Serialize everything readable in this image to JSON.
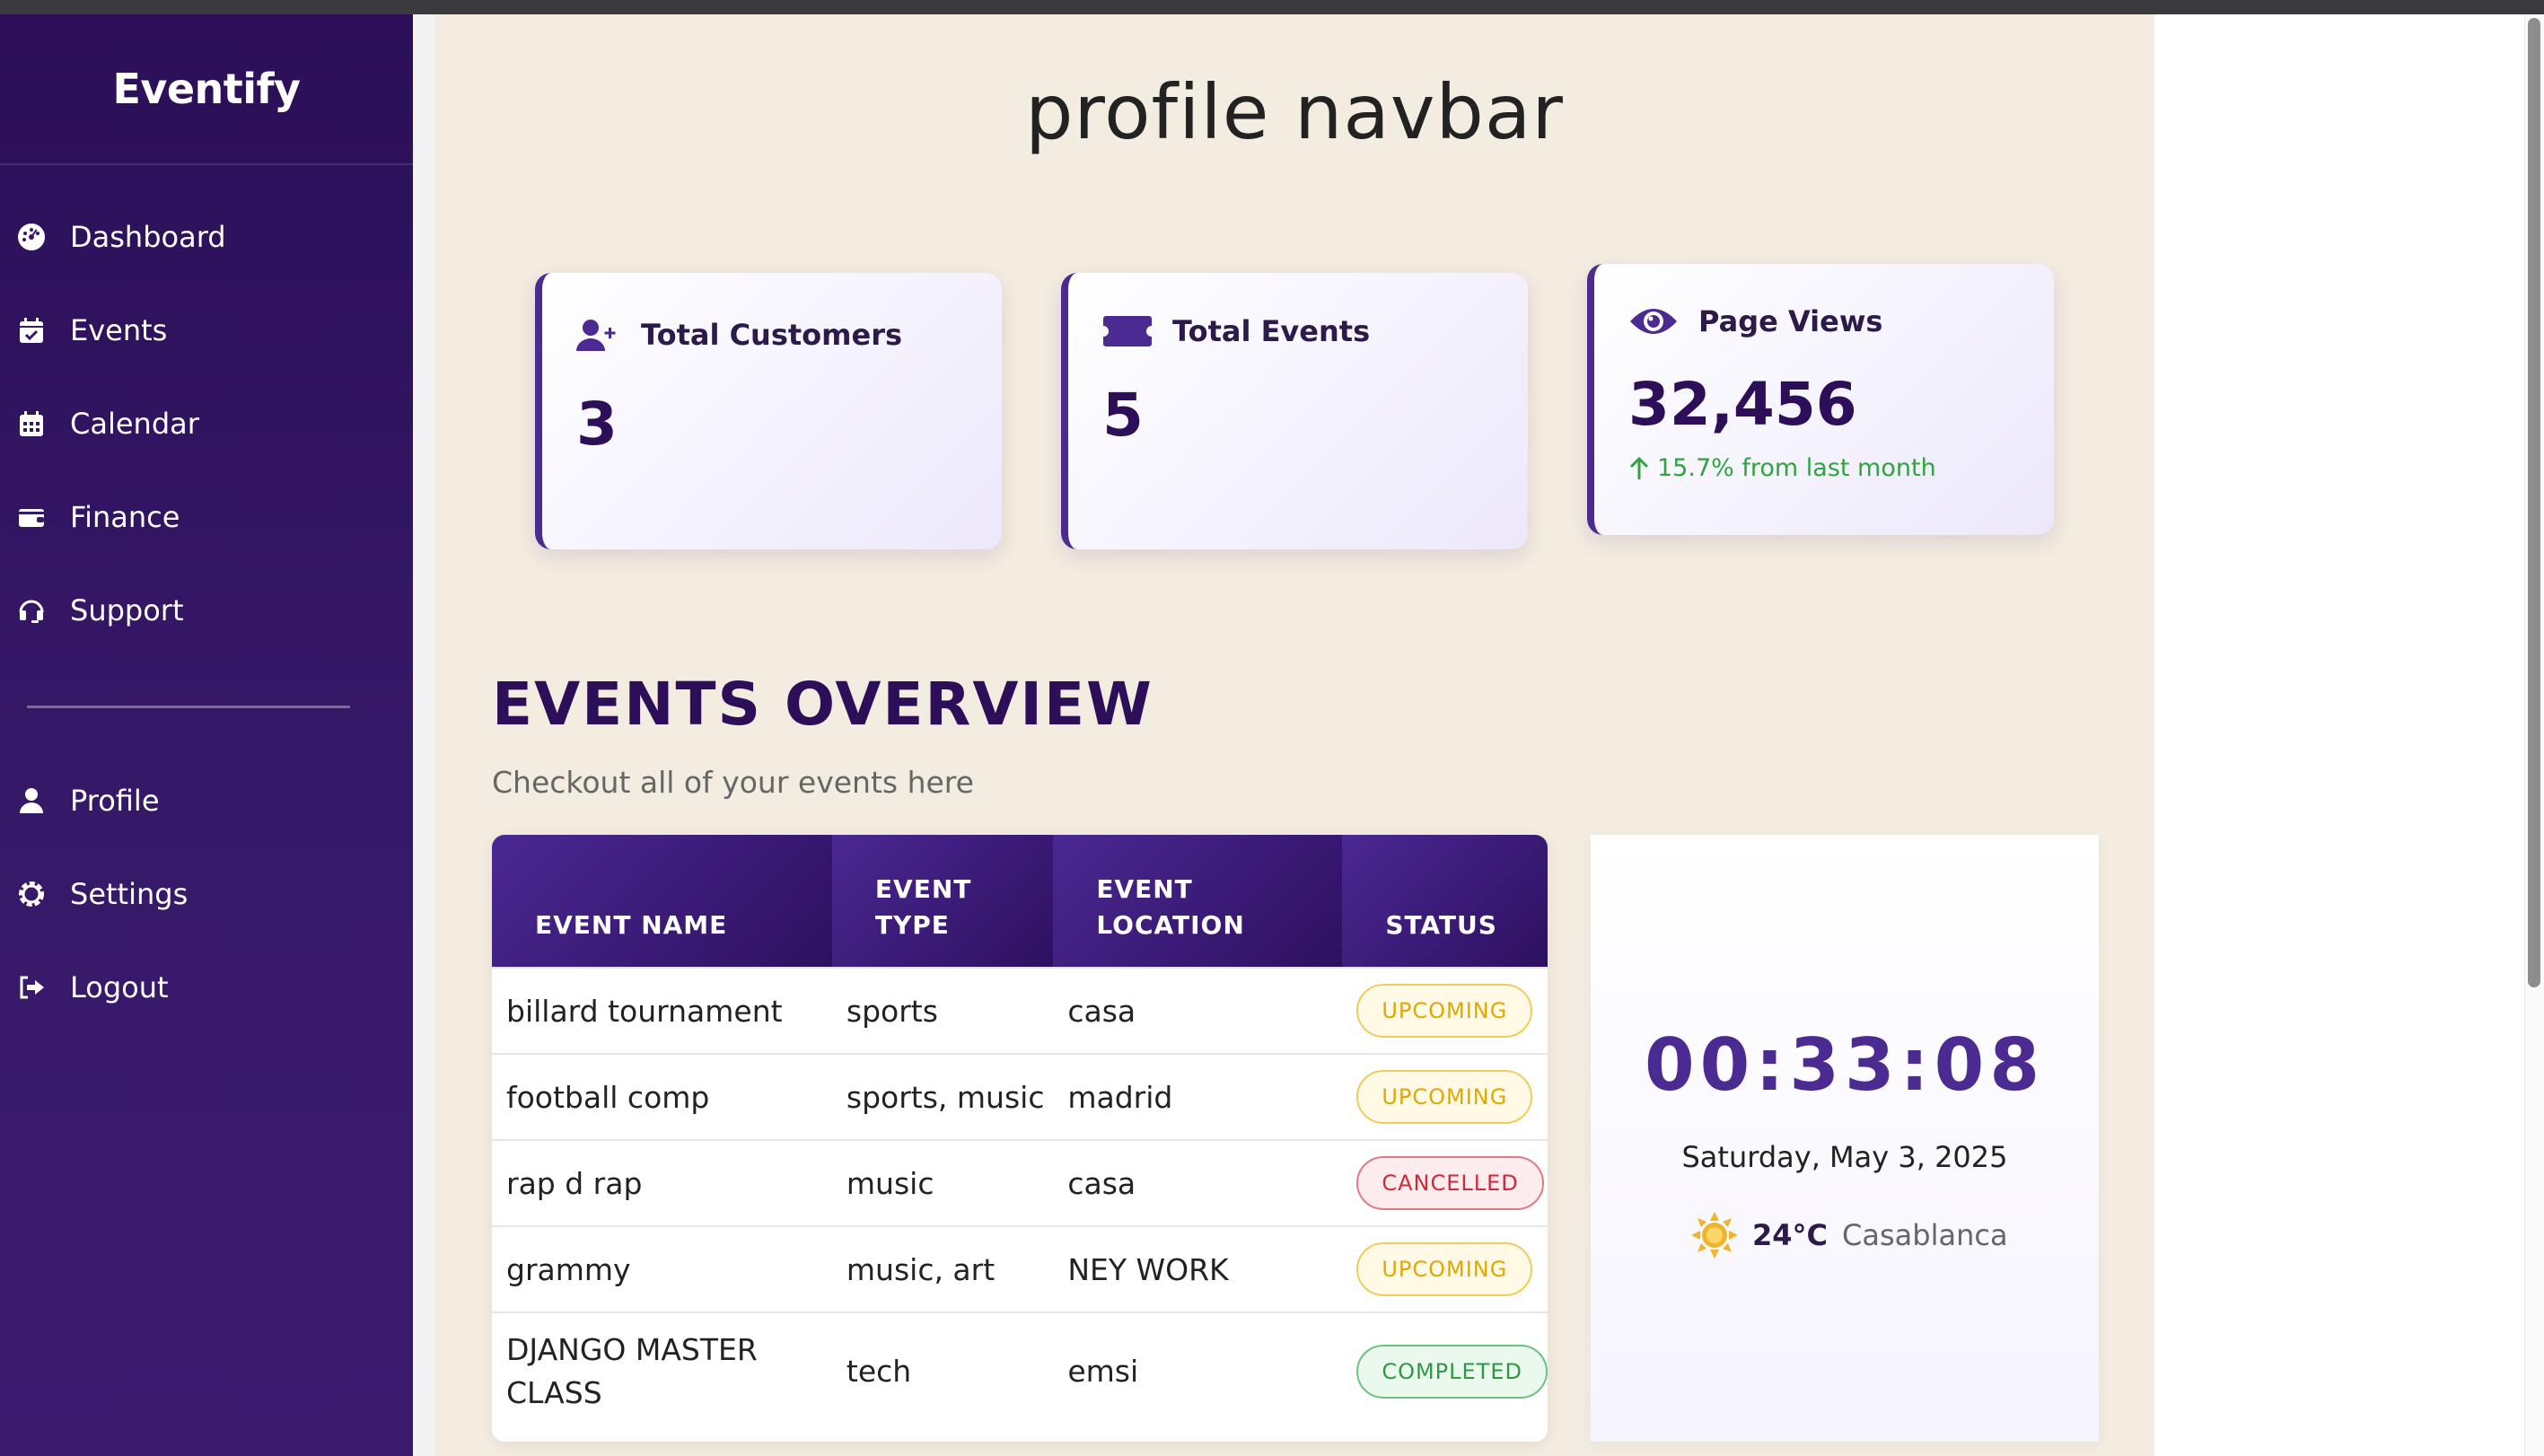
{
  "sidebar": {
    "brand": "Eventify",
    "items": [
      {
        "label": "Dashboard",
        "icon": "dashboard-icon"
      },
      {
        "label": "Events",
        "icon": "calendar-check-icon"
      },
      {
        "label": "Calendar",
        "icon": "calendar-icon"
      },
      {
        "label": "Finance",
        "icon": "wallet-icon"
      },
      {
        "label": "Support",
        "icon": "headset-icon"
      }
    ],
    "bottom_items": [
      {
        "label": "Profile",
        "icon": "user-icon"
      },
      {
        "label": "Settings",
        "icon": "gear-icon"
      },
      {
        "label": "Logout",
        "icon": "logout-icon"
      }
    ]
  },
  "main": {
    "title": "profile navbar",
    "cards": [
      {
        "label": "Total Customers",
        "value": "3",
        "icon": "user-plus-icon"
      },
      {
        "label": "Total Events",
        "value": "5",
        "icon": "ticket-icon"
      },
      {
        "label": "Page Views",
        "value": "32,456",
        "trend": "15.7% from last month",
        "icon": "eye-icon"
      }
    ],
    "section_title": "EVENTS OVERVIEW",
    "section_subtitle": "Checkout all of your events here",
    "table": {
      "headers": [
        "EVENT NAME",
        "EVENT TYPE",
        "EVENT LOCATION",
        "STATUS"
      ],
      "rows": [
        {
          "name": "billard tournament",
          "type": "sports",
          "location": "casa",
          "status": "UPCOMING"
        },
        {
          "name": "football comp",
          "type": "sports, music",
          "location": "madrid",
          "status": "UPCOMING"
        },
        {
          "name": "rap d rap",
          "type": "music",
          "location": "casa",
          "status": "CANCELLED"
        },
        {
          "name": "grammy",
          "type": "music, art",
          "location": "NEY WORK",
          "status": "UPCOMING"
        },
        {
          "name": "DJANGO MASTER CLASS",
          "type": "tech",
          "location": "emsi",
          "status": "COMPLETED"
        }
      ]
    },
    "clock": {
      "time": "00:33:08",
      "date": "Saturday, May 3, 2025",
      "temperature": "24°C",
      "city": "Casablanca",
      "weather_icon": "sun-icon"
    }
  },
  "colors": {
    "sidebar_bg": "#2c0f58",
    "accent": "#4b2a91",
    "main_bg": "#f3ece0",
    "status_upcoming": "#e0a800",
    "status_cancelled": "#d0293a",
    "status_completed": "#2c9a43",
    "trend_up": "#2fa43f"
  }
}
